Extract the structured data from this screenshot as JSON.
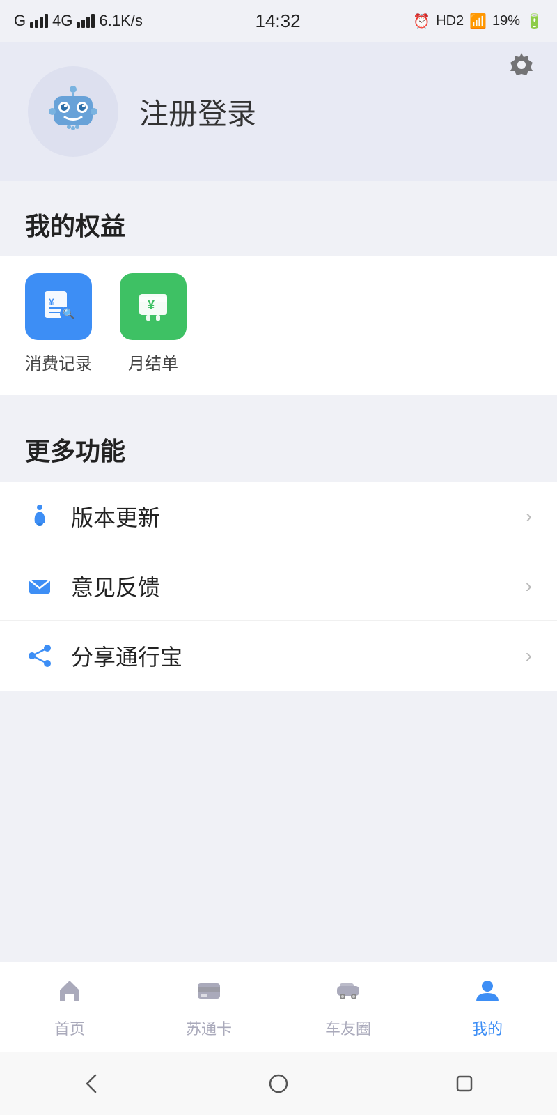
{
  "statusBar": {
    "carrier": "G",
    "network": "4G",
    "speed": "6.1K/s",
    "time": "14:32",
    "alarm": "HD2",
    "wifi": "19%",
    "battery": "19%"
  },
  "header": {
    "title": "注册登录",
    "settingsIcon": "⬡"
  },
  "benefits": {
    "sectionTitle": "我的权益",
    "items": [
      {
        "label": "消费记录",
        "color": "blue",
        "icon": "¥🔍"
      },
      {
        "label": "月结单",
        "color": "green",
        "icon": "¥"
      }
    ]
  },
  "moreFeatures": {
    "sectionTitle": "更多功能",
    "items": [
      {
        "icon": "🔔",
        "label": "版本更新",
        "iconColor": "#3d8ef5"
      },
      {
        "icon": "✉",
        "label": "意见反馈",
        "iconColor": "#3d8ef5"
      },
      {
        "icon": "⑂",
        "label": "分享通行宝",
        "iconColor": "#3d8ef5"
      }
    ]
  },
  "bottomNav": {
    "items": [
      {
        "label": "首页",
        "active": false,
        "icon": "⌂"
      },
      {
        "label": "苏通卡",
        "active": false,
        "icon": "▤"
      },
      {
        "label": "车友圈",
        "active": false,
        "icon": "🚗"
      },
      {
        "label": "我的",
        "active": true,
        "icon": "👤"
      }
    ]
  },
  "systemNav": {
    "back": "◁",
    "home": "○",
    "recent": "□"
  }
}
